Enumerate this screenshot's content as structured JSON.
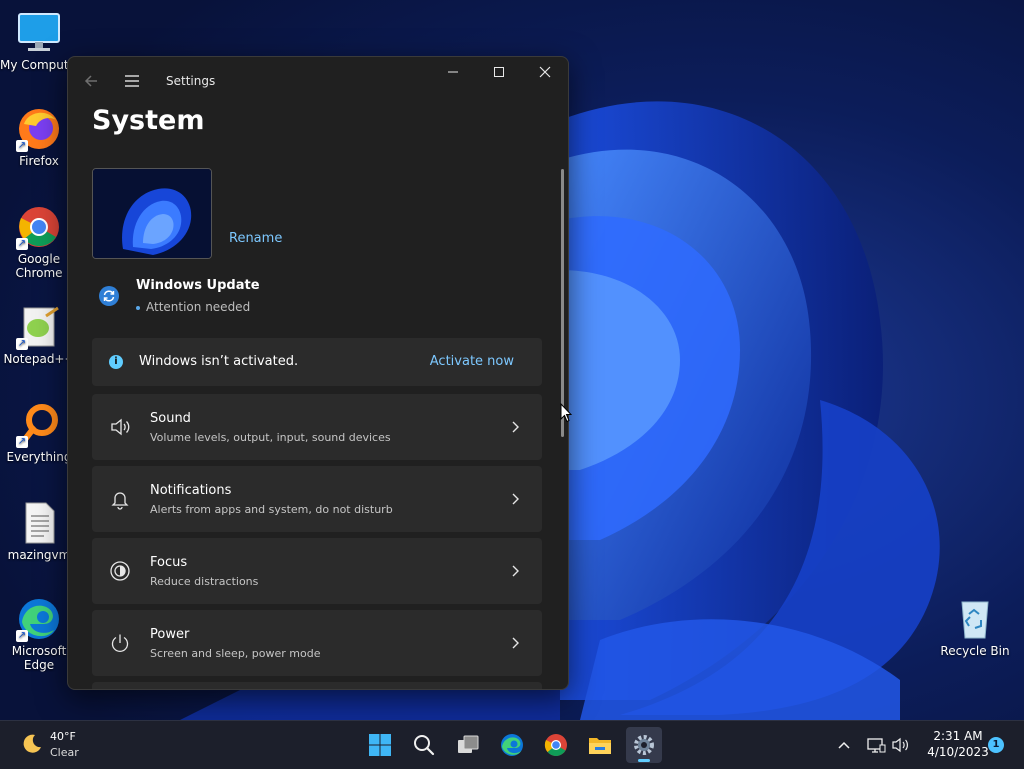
{
  "desktop": {
    "icons": [
      {
        "label": "My Computer"
      },
      {
        "label": "Firefox"
      },
      {
        "label": "Google Chrome"
      },
      {
        "label": "Notepad++"
      },
      {
        "label": "Everything"
      },
      {
        "label": "mazingvm"
      },
      {
        "label": "Microsoft Edge"
      },
      {
        "label": "Recycle Bin"
      }
    ]
  },
  "window": {
    "title": "Settings",
    "page_title": "System",
    "rename_label": "Rename",
    "windows_update": {
      "title": "Windows Update",
      "status": "Attention needed"
    },
    "activation": {
      "message": "Windows isn’t activated.",
      "action": "Activate now"
    },
    "items": [
      {
        "title": "Sound",
        "description": "Volume levels, output, input, sound devices",
        "icon": "speaker-icon"
      },
      {
        "title": "Notifications",
        "description": "Alerts from apps and system, do not disturb",
        "icon": "bell-icon"
      },
      {
        "title": "Focus",
        "description": "Reduce distractions",
        "icon": "focus-icon"
      },
      {
        "title": "Power",
        "description": "Screen and sleep, power mode",
        "icon": "power-icon"
      }
    ]
  },
  "taskbar": {
    "weather": {
      "temp": "40°F",
      "condition": "Clear",
      "icon": "moon-icon"
    },
    "apps": [
      "start",
      "search",
      "task-view",
      "edge",
      "chrome",
      "file-explorer",
      "settings"
    ],
    "active_app": "settings",
    "clock": {
      "time": "2:31 AM",
      "date": "4/10/2023"
    },
    "notification_count": "1"
  },
  "colors": {
    "accent": "#60cdff",
    "link": "#7dc8ff",
    "window_bg": "#202020",
    "card_bg": "#2b2b2b",
    "taskbar_bg": "#1c1f2b"
  }
}
